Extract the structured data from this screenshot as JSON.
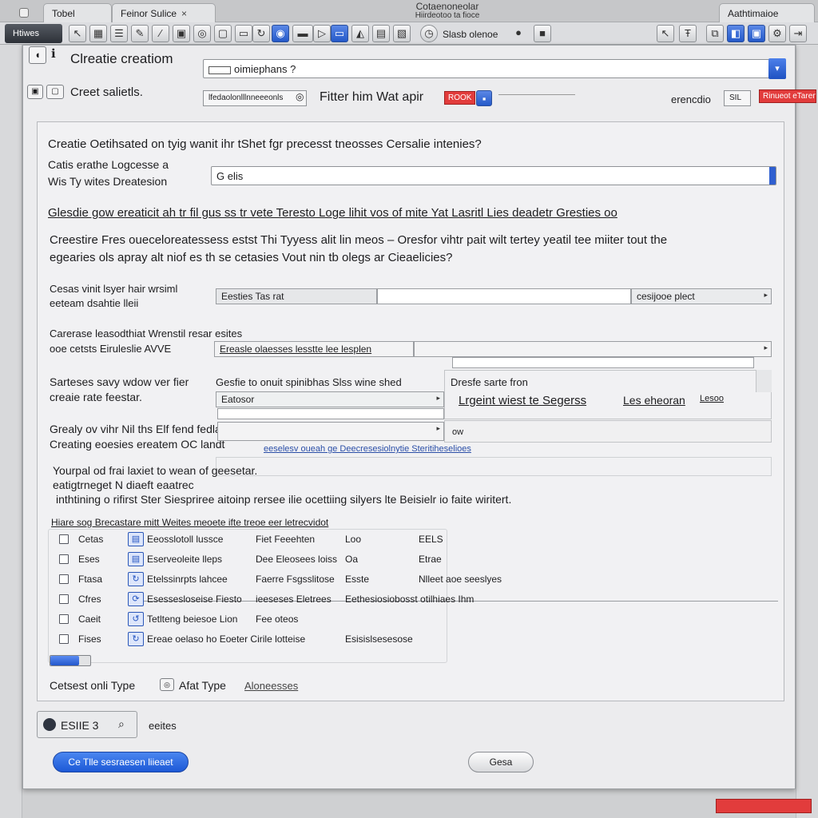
{
  "chrome": {
    "tabs": [
      {
        "label": "Tobel"
      },
      {
        "label": "Feinor Sulice"
      }
    ],
    "window_title_line1": "Cotaenoneolar",
    "window_title_line2": "Hiirdeotoo ta fioce",
    "right_tab": "Aathtimaioe",
    "mode_button": "Htiwes",
    "toolbar_label": "Slasb olenoe"
  },
  "header": {
    "title": "Clreatie creatiom",
    "subtitle": "Creet salietls.",
    "main_field_value": "oimiephans ?",
    "sub_field_value": "lfedaolonlllnneeeonls",
    "filter_label": "Fitter him Wat apir",
    "filter_badge": "ROOK",
    "right_label": "erencdio",
    "right_box": "SIL",
    "red_tag": "Rinueot eTarenll"
  },
  "form": {
    "question": "Creatie Oetihsated on tyig wanit ihr tShet fgr precesst tneosses Cersalie intenies?",
    "q1_label_line1": "Catis erathe Logcesse a",
    "q1_label_line2": "Wis Ty   wites Dreatesion",
    "q1_value": "G elis",
    "link_row": "Glesdie gow ereaticit ah tr fil gus  ss tr vete  Teresto Loge lihit vos of mite  Yat Lasritl Lies  deadetr  Gresties oo",
    "para_line1": "Creestire Fres oueceloreatessess estst Thi Tyyess alit lin meos – Oresfor vihtr pait wilt tertey yeatil tee miiter tout the",
    "para_line2": "egearies ols apray alt niof es th se cetasies  Vout nin tb olegs ar Cieaelicies?",
    "r1_label_line1": "Cesas vinit lsyer hair wrsiml",
    "r1_label_line2": "eeteam dsahtie lleii",
    "r1_field": "Eesties Tas rat",
    "r1_combo": "cesijooe plect",
    "r2_label_line1": "Carerase leasodthiat Wrenstil resar esites",
    "r2_label_line2": "ooe cetsts  Eiruleslie AVVE",
    "r2_field": "Ereasle olaesses lesstte lee lesplen",
    "r3_label_line1": "Sarteses savy wdow ver fier",
    "r3_label_line2": "creaie rate feestar.",
    "r3_header": "Gesfie to onuit spinibhas Slss wine shed",
    "r3_side_header": "Dresfe sarte fron",
    "r3_field": "Eatosor",
    "r3_side_text": "Lrgeint wiest te  Segerss",
    "r3_side_text2": "Les eheoran",
    "r3_side_num": "Lesoo",
    "r4_label_line1": "Grealy ov vihr Nil ths Elf fend fedlatid?",
    "r4_label_line2": "Creating eoesies ereatem OC  landt",
    "r4_sub": "ow",
    "r4_link": "eeselesv oueah ge Deecresesiolnytie Steritiheselioes",
    "note_line1": "Yourpal od frai laxiet to wean of geesetar.",
    "note_line2": "eatigtrneget N diaeft eaatrec",
    "note_line3": "inthtining  o rifirst Ster Siespriree aitoinp rersee ilie ocettiing silyers lte Beisielr io faite wiritert."
  },
  "list": {
    "header": "Hiare sog Brecastare mitt Weites meoete ifte treoe eer letrecvidot",
    "rows": [
      {
        "label": "Cetas",
        "icon": "▤",
        "col1": "Eeosslotoll lussce",
        "col2": "Fiet Feeehten",
        "col3": "Loo",
        "col4": "EELS",
        "checked": false
      },
      {
        "label": "Eses",
        "icon": "▤",
        "col1": "Eserveoleite lleps",
        "col2": "Dee Eleosees loiss",
        "col3": "Oa",
        "col4": "Etrae",
        "checked": false
      },
      {
        "label": "Ftasa",
        "icon": "↻",
        "col1": "Etelssinrpts lahcee",
        "col2": "Faerre Fsgsslitose",
        "col3": "Esste",
        "col4": "Nlleet aoe seeslyes",
        "checked": false
      },
      {
        "label": "Cfres",
        "icon": "⟳",
        "col1": "Esessesloseise Fiesto",
        "col2": "ieeseses Eletrees",
        "col3": "Eethesiosiobosst otilhiaes Ihm",
        "col4": "",
        "checked": false
      },
      {
        "label": "Caeit",
        "icon": "↺",
        "col1": "Tetlteng beiesoe Lion",
        "col2": "Fee oteos",
        "col3": "",
        "col4": "",
        "checked": false
      },
      {
        "label": "Fises",
        "icon": "↻",
        "col1": "Ereae oelaso ho Eoeter Cirile lotteise",
        "col2": "",
        "col3": "Esisislsesesose",
        "col4": "",
        "checked": false
      }
    ]
  },
  "progress": {
    "fraction": 0.72
  },
  "bottom": {
    "content_type_label": "Cetsest onli Type",
    "content_type_label2": "Afat Type",
    "content_type_link": "Aloneesses",
    "counter_value": "ESIIE 3",
    "counter_label": "eeites",
    "primary_button": "Ce Tlle sesraesen liieaet",
    "secondary_button": "Gesa"
  },
  "colors": {
    "accent": "#2459c9",
    "alert": "#e23c3c",
    "panel": "#ececee"
  }
}
